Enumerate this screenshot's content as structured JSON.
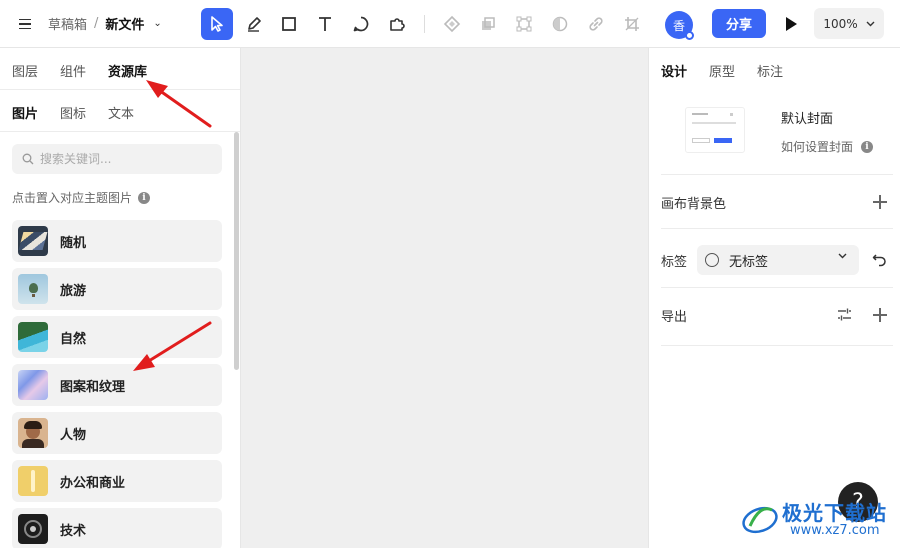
{
  "breadcrumb": {
    "parent": "草稿箱",
    "separator": "/",
    "current": "新文件"
  },
  "toolbar": {
    "tools": [
      "select-tool",
      "pen-tool",
      "rectangle-tool",
      "text-tool",
      "comment-tool",
      "plugin-tool"
    ],
    "disabled_tools": [
      "component-tool",
      "boolean-tool",
      "frame-tool",
      "mask-tool",
      "link-tool",
      "crop-tool"
    ]
  },
  "header": {
    "avatar_text": "香",
    "share_label": "分享",
    "zoom_label": "100%"
  },
  "left_panel": {
    "tabs": [
      "图层",
      "组件",
      "资源库"
    ],
    "selected_tab": "资源库",
    "subtabs": [
      "图片",
      "图标",
      "文本"
    ],
    "selected_subtab": "图片",
    "search_placeholder": "搜索关键词...",
    "hint": "点击置入对应主题图片",
    "categories": [
      {
        "label": "随机",
        "thumb": "random"
      },
      {
        "label": "旅游",
        "thumb": "travel"
      },
      {
        "label": "自然",
        "thumb": "nature"
      },
      {
        "label": "图案和纹理",
        "thumb": "pattern"
      },
      {
        "label": "人物",
        "thumb": "people"
      },
      {
        "label": "办公和商业",
        "thumb": "office"
      },
      {
        "label": "技术",
        "thumb": "tech"
      }
    ]
  },
  "right_panel": {
    "tabs": [
      "设计",
      "原型",
      "标注"
    ],
    "selected_tab": "设计",
    "cover_title": "默认封面",
    "cover_link": "如何设置封面",
    "canvas_bg_label": "画布背景色",
    "tag_label": "标签",
    "tag_value": "无标签",
    "export_label": "导出"
  },
  "help_label": "?",
  "watermark": {
    "line1": "极光下载站",
    "line2": "www.xz7.com"
  },
  "colors": {
    "accent": "#3a66f5",
    "arrow": "#e11d1d",
    "canvas": "#efefef"
  }
}
